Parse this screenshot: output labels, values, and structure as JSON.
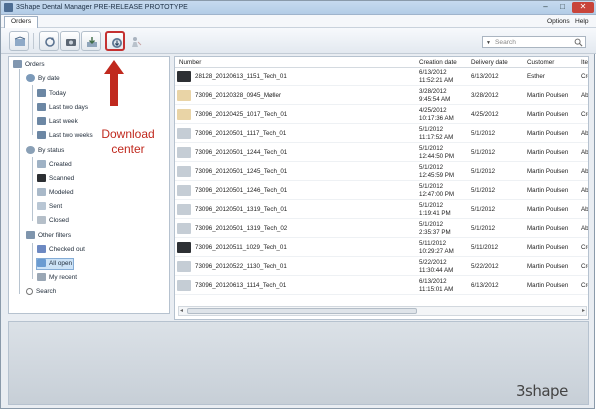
{
  "window": {
    "title": "3Shape Dental Manager PRE-RELEASE PROTOTYPE",
    "min": "–",
    "max": "□",
    "close": "✕"
  },
  "menu": {
    "tab": "Orders",
    "options": "Options",
    "help": "Help"
  },
  "search": {
    "placeholder": "Search"
  },
  "tree": {
    "root": "Orders",
    "by_date": "By date",
    "today": "Today",
    "last_two_days": "Last two days",
    "last_week": "Last week",
    "last_two_weeks": "Last two weeks",
    "by_status": "By status",
    "created": "Created",
    "scanned": "Scanned",
    "modeled": "Modeled",
    "sent": "Sent",
    "closed": "Closed",
    "other": "Other filters",
    "checked_out": "Checked out",
    "all_open": "All open",
    "my_recent": "My recent",
    "search": "Search"
  },
  "columns": [
    "Number",
    "Creation date",
    "Delivery date",
    "Customer",
    "Ite"
  ],
  "rows": [
    {
      "number": "28128_20120613_1151_Tech_01",
      "created_date": "6/13/2012",
      "created_time": "11:52:21 AM",
      "delivery": "6/13/2012",
      "customer": "Esther",
      "item": "Cro"
    },
    {
      "number": "73096_20120328_0945_Møller",
      "created_date": "3/28/2012",
      "created_time": "9:45:54 AM",
      "delivery": "3/28/2012",
      "customer": "Martin Poulsen",
      "item": "Ab"
    },
    {
      "number": "73096_20120425_1017_Tech_01",
      "created_date": "4/25/2012",
      "created_time": "10:17:36 AM",
      "delivery": "4/25/2012",
      "customer": "Martin Poulsen",
      "item": "Cro"
    },
    {
      "number": "73096_20120501_1117_Tech_01",
      "created_date": "5/1/2012",
      "created_time": "11:17:52 AM",
      "delivery": "5/1/2012",
      "customer": "Martin Poulsen",
      "item": "Abi"
    },
    {
      "number": "73096_20120501_1244_Tech_01",
      "created_date": "5/1/2012",
      "created_time": "12:44:50 PM",
      "delivery": "5/1/2012",
      "customer": "Martin Poulsen",
      "item": "Abi"
    },
    {
      "number": "73096_20120501_1245_Tech_01",
      "created_date": "5/1/2012",
      "created_time": "12:45:59 PM",
      "delivery": "5/1/2012",
      "customer": "Martin Poulsen",
      "item": "Abi"
    },
    {
      "number": "73096_20120501_1246_Tech_01",
      "created_date": "5/1/2012",
      "created_time": "12:47:00 PM",
      "delivery": "5/1/2012",
      "customer": "Martin Poulsen",
      "item": "Abi"
    },
    {
      "number": "73096_20120501_1319_Tech_01",
      "created_date": "5/1/2012",
      "created_time": "1:19:41 PM",
      "delivery": "5/1/2012",
      "customer": "Martin Poulsen",
      "item": "Abi"
    },
    {
      "number": "73096_20120501_1319_Tech_02",
      "created_date": "5/1/2012",
      "created_time": "2:35:37 PM",
      "delivery": "5/1/2012",
      "customer": "Martin Poulsen",
      "item": "Abi"
    },
    {
      "number": "73096_20120511_1029_Tech_01",
      "created_date": "5/11/2012",
      "created_time": "10:29:27 AM",
      "delivery": "5/11/2012",
      "customer": "Martin Poulsen",
      "item": "Cro"
    },
    {
      "number": "73096_20120522_1130_Tech_01",
      "created_date": "5/22/2012",
      "created_time": "11:30:44 AM",
      "delivery": "5/22/2012",
      "customer": "Martin Poulsen",
      "item": "Cro"
    },
    {
      "number": "73096_20120613_1114_Tech_01",
      "created_date": "6/13/2012",
      "created_time": "11:15:01 AM",
      "delivery": "6/13/2012",
      "customer": "Martin Poulsen",
      "item": "Cro"
    }
  ],
  "row_icons": [
    "scanner-icon",
    "document-warning-icon",
    "document-error-icon",
    "scanner-icon",
    "scanner-icon",
    "scanner-icon",
    "scanner-icon",
    "scanner-icon",
    "scanner-icon",
    "scanner-icon",
    "scanner-icon",
    "scanner-icon"
  ],
  "colors": {
    "accent": "#c43131",
    "selection": "#cde3f7",
    "callout": "#c0291e"
  },
  "callout": "Download center",
  "brand": "3shape"
}
